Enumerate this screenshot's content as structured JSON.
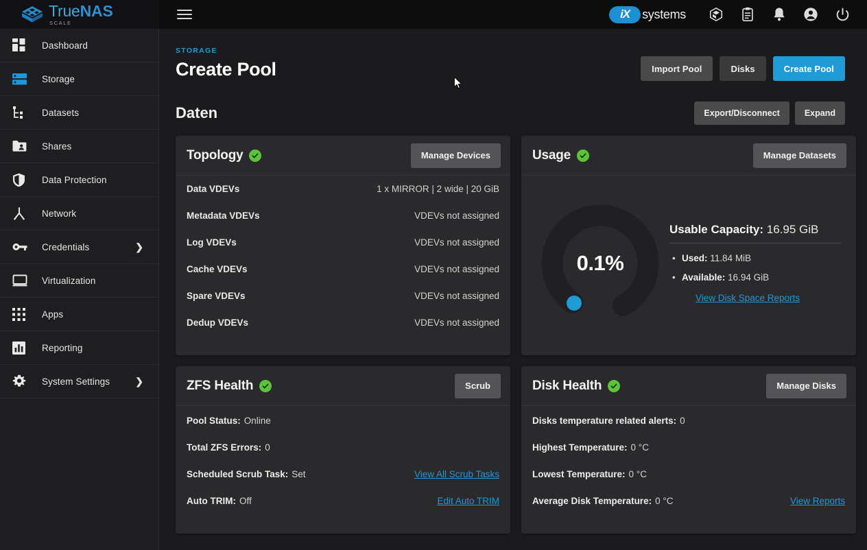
{
  "topbar": {
    "logo_primary": "True",
    "logo_secondary": "NAS",
    "logo_sub": "SCALE",
    "menu_icon": "hamburger-menu-icon",
    "brand_ix": "iX",
    "brand_systems": "systems",
    "icons": [
      {
        "name": "apps-cube-icon"
      },
      {
        "name": "clipboard-tasks-icon"
      },
      {
        "name": "notifications-bell-icon"
      },
      {
        "name": "user-account-icon"
      },
      {
        "name": "power-icon"
      }
    ]
  },
  "sidebar": {
    "items": [
      {
        "label": "Dashboard",
        "icon": "dashboard-icon",
        "active": false,
        "expandable": false
      },
      {
        "label": "Storage",
        "icon": "storage-icon",
        "active": true,
        "expandable": false
      },
      {
        "label": "Datasets",
        "icon": "datasets-tree-icon",
        "active": false,
        "expandable": false
      },
      {
        "label": "Shares",
        "icon": "shares-folder-icon",
        "active": false,
        "expandable": false
      },
      {
        "label": "Data Protection",
        "icon": "shield-icon",
        "active": false,
        "expandable": false
      },
      {
        "label": "Network",
        "icon": "network-icon",
        "active": false,
        "expandable": false
      },
      {
        "label": "Credentials",
        "icon": "key-icon",
        "active": false,
        "expandable": true
      },
      {
        "label": "Virtualization",
        "icon": "monitor-icon",
        "active": false,
        "expandable": false
      },
      {
        "label": "Apps",
        "icon": "apps-grid-icon",
        "active": false,
        "expandable": false
      },
      {
        "label": "Reporting",
        "icon": "bar-chart-icon",
        "active": false,
        "expandable": false
      },
      {
        "label": "System Settings",
        "icon": "gear-icon",
        "active": false,
        "expandable": true
      }
    ]
  },
  "page": {
    "breadcrumb": "STORAGE",
    "title": "Create Pool",
    "actions": {
      "import_pool": "Import Pool",
      "disks": "Disks",
      "create_pool": "Create Pool"
    }
  },
  "pool": {
    "name": "Daten",
    "actions": {
      "export_disconnect": "Export/Disconnect",
      "expand": "Expand"
    }
  },
  "topology": {
    "title": "Topology",
    "status_icon": "check-circle-icon",
    "manage_button": "Manage Devices",
    "rows": [
      {
        "key": "Data VDEVs",
        "value": "1 x MIRROR | 2 wide | 20 GiB"
      },
      {
        "key": "Metadata VDEVs",
        "value": "VDEVs not assigned"
      },
      {
        "key": "Log VDEVs",
        "value": "VDEVs not assigned"
      },
      {
        "key": "Cache VDEVs",
        "value": "VDEVs not assigned"
      },
      {
        "key": "Spare VDEVs",
        "value": "VDEVs not assigned"
      },
      {
        "key": "Dedup VDEVs",
        "value": "VDEVs not assigned"
      }
    ]
  },
  "usage": {
    "title": "Usage",
    "status_icon": "check-circle-icon",
    "manage_button": "Manage Datasets",
    "gauge_percent_label": "0.1%",
    "capacity_label": "Usable Capacity:",
    "capacity_value": "16.95 GiB",
    "used_label": "Used:",
    "used_value": "11.84 MiB",
    "available_label": "Available:",
    "available_value": "16.94 GiB",
    "report_link": "View Disk Space Reports"
  },
  "zfs_health": {
    "title": "ZFS Health",
    "status_icon": "check-circle-icon",
    "scrub_button": "Scrub",
    "rows": [
      {
        "key": "Pool Status:",
        "value": "Online",
        "link": ""
      },
      {
        "key": "Total ZFS Errors:",
        "value": "0",
        "link": ""
      },
      {
        "key": "Scheduled Scrub Task:",
        "value": "Set",
        "link": "View All Scrub Tasks"
      },
      {
        "key": "Auto TRIM:",
        "value": "Off",
        "link": "Edit Auto TRIM"
      }
    ]
  },
  "disk_health": {
    "title": "Disk Health",
    "status_icon": "check-circle-icon",
    "manage_button": "Manage Disks",
    "rows": [
      {
        "key": "Disks temperature related alerts:",
        "value": "0",
        "link": ""
      },
      {
        "key": "Highest Temperature:",
        "value": "0 °C",
        "link": ""
      },
      {
        "key": "Lowest Temperature:",
        "value": "0 °C",
        "link": ""
      },
      {
        "key": "Average Disk Temperature:",
        "value": "0 °C",
        "link": "View Reports"
      }
    ]
  },
  "colors": {
    "accent_blue": "#1f9bd6",
    "status_green": "#5cc43a",
    "page_bg": "#1b1b1d",
    "card_bg": "#2a2a2c",
    "topbar_bg": "#0d0d0e"
  },
  "chart_data": {
    "type": "pie",
    "title": "Pool Usage",
    "categories": [
      "Used",
      "Available"
    ],
    "values": [
      0.1,
      99.9
    ],
    "unit": "%",
    "center_label": "0.1%",
    "detail": {
      "used_gib": 0.011562,
      "available_gib": 16.94,
      "total_gib": 16.95
    }
  }
}
